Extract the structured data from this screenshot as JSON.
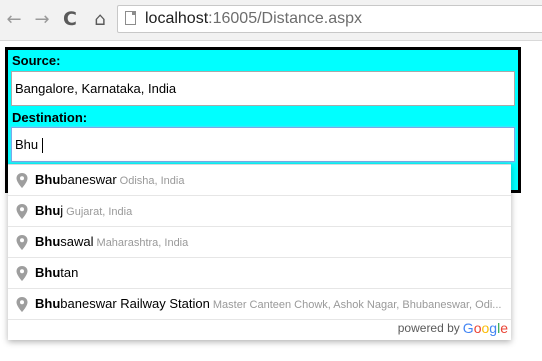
{
  "browser": {
    "url_host": "localhost",
    "url_path": ":16005/Distance.aspx",
    "back_icon": "←",
    "forward_icon": "→",
    "reload_icon": "C",
    "home_icon": "⌂"
  },
  "form": {
    "source_label": "Source:",
    "source_value": "Bangalore, Karnataka, India",
    "destination_label": "Destination:",
    "destination_value": "Bhu",
    "panel_color": "#00ffff"
  },
  "autocomplete": {
    "items": [
      {
        "match": "Bhu",
        "rest": "baneswar",
        "secondary": "Odisha, India"
      },
      {
        "match": "Bhu",
        "rest": "j",
        "secondary": "Gujarat, India"
      },
      {
        "match": "Bhu",
        "rest": "sawal",
        "secondary": "Maharashtra, India"
      },
      {
        "match": "Bhu",
        "rest": "tan",
        "secondary": ""
      },
      {
        "match": "Bhu",
        "rest": "baneswar Railway Station",
        "secondary": "Master Canteen Chowk, Ashok Nagar, Bhubaneswar, Odi..."
      }
    ],
    "powered_by": "powered by",
    "logo_letters": [
      {
        "ch": "G",
        "color": "#4285f4"
      },
      {
        "ch": "o",
        "color": "#ea4335"
      },
      {
        "ch": "o",
        "color": "#fbbc05"
      },
      {
        "ch": "g",
        "color": "#4285f4"
      },
      {
        "ch": "l",
        "color": "#34a853"
      },
      {
        "ch": "e",
        "color": "#ea4335"
      }
    ]
  }
}
